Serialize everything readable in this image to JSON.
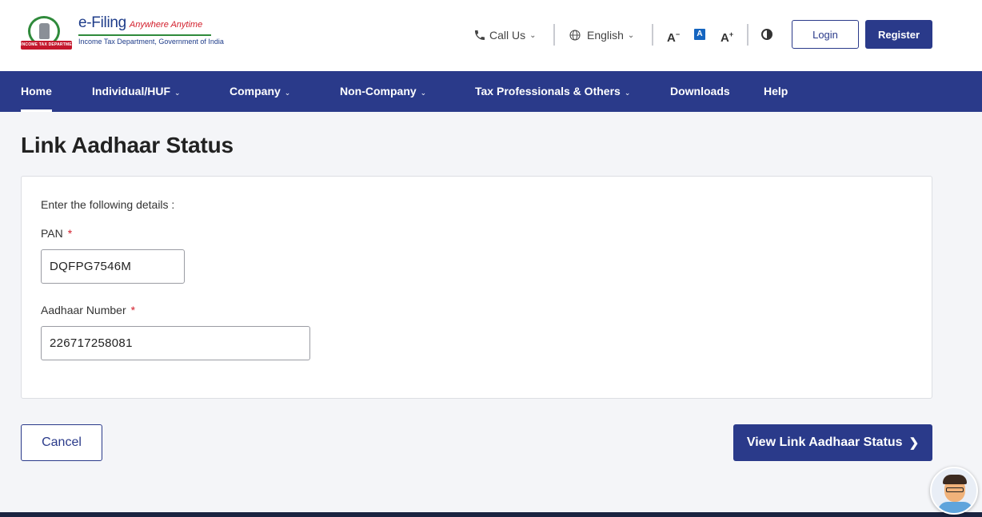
{
  "header": {
    "brand": "e-Filing",
    "tagline": "Anywhere Anytime",
    "department": "Income Tax Department, Government of India",
    "emblem_ribbon": "INCOME TAX DEPARTMENT",
    "call_us": "Call Us",
    "language": "English",
    "font_decrease": "A",
    "font_normal": "A",
    "font_increase": "A",
    "login": "Login",
    "register": "Register"
  },
  "nav": {
    "items": [
      {
        "label": "Home",
        "active": true,
        "dropdown": false
      },
      {
        "label": "Individual/HUF",
        "dropdown": true
      },
      {
        "label": "Company",
        "dropdown": true
      },
      {
        "label": "Non-Company",
        "dropdown": true
      },
      {
        "label": "Tax Professionals & Others",
        "dropdown": true
      },
      {
        "label": "Downloads",
        "dropdown": false
      },
      {
        "label": "Help",
        "dropdown": false
      }
    ]
  },
  "page": {
    "title": "Link Aadhaar Status",
    "intro": "Enter the following details :",
    "pan_label": "PAN",
    "pan_value": "DQFPG7546M",
    "aadhaar_label": "Aadhaar Number",
    "aadhaar_value": "226717258081",
    "required_marker": "*"
  },
  "actions": {
    "cancel": "Cancel",
    "view_status": "View Link Aadhaar Status"
  },
  "colors": {
    "primary": "#2a3a8a",
    "required": "#d21e2b",
    "background": "#f4f5f8"
  }
}
